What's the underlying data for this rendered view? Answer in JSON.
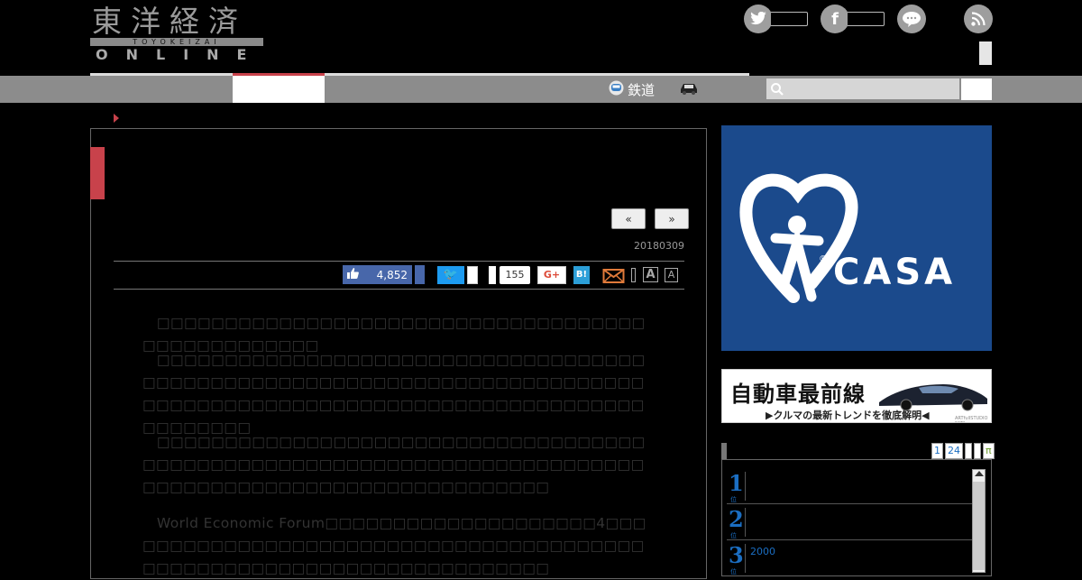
{
  "header": {
    "logo": {
      "kanji": "東洋経済",
      "sub": "TOYOKEIZAI",
      "online": "ONLINE"
    },
    "social": [
      {
        "name": "twitter",
        "glyph": "🐦"
      },
      {
        "name": "facebook",
        "glyph": "f"
      },
      {
        "name": "line",
        "glyph": "💬"
      },
      {
        "name": "rss",
        "glyph": "◉"
      }
    ]
  },
  "nav": {
    "rail_label": "鉄道",
    "search": {
      "placeholder": ""
    }
  },
  "article": {
    "pager": {
      "prev": "«",
      "next": "»"
    },
    "date": "20180309",
    "share": {
      "fb_count": "4,852",
      "tw_label": "🐦",
      "hatena_count": "155",
      "gplus_label": "G+",
      "hatena_label": "B!",
      "font_large": "A",
      "font_small": "A"
    },
    "paragraphs": [
      "　□□□□□□□□□□□□□□□□□□□□□□□□□□□□□□□□□□□□□□□□□□□□□□□□□",
      "　□□□□□□□□□□□□□□□□□□□□□□□□□□□□□□□□□□□□□□□□□□□□□□□□□□□□□□□□□□□□□□□□□□□□□□□□□□□□□□□□□□□□□□□□□□□□□□□□□□□□□□□□□□□□□□□□□□□□□□",
      "　□□□□□□□□□□□□□□□□□□□□□□□□□□□□□□□□□□□□□□□□□□□□□□□□□□□□□□□□□□□□□□□□□□□□□□□□□□□□□□□□□□□□□□□□□□□□□□□□□□□□□□□",
      "　World Economic Forum□□□□□□□□□□□□□□□□□□□□4□□□□□□□□□□□□□□□□□□□□□□□□□□□□□□□□□□□□□□□□□□□□□□□□□□□□□□□□□□□□□□□□□□□□□□"
    ]
  },
  "sidebar": {
    "ad_casa": {
      "text": "CASA",
      "reg": "®"
    },
    "ad_car": {
      "title": "自動車最前線",
      "sub": "▶クルマの最新トレンドを徹底解明◀",
      "credit": "ARTfullSTUDIO PATA"
    },
    "ranking": {
      "tabs": [
        "1",
        "24",
        "",
        "",
        "π"
      ],
      "unit": "位",
      "items": [
        {
          "rank": "1",
          "text": ""
        },
        {
          "rank": "2",
          "text": ""
        },
        {
          "rank": "3",
          "text": "2000"
        }
      ]
    }
  },
  "colors": {
    "accent": "#c8424b",
    "nav_bg": "#8c8c8c",
    "link_blue": "#1b6ec2",
    "casa_blue": "#1b4a8c"
  }
}
